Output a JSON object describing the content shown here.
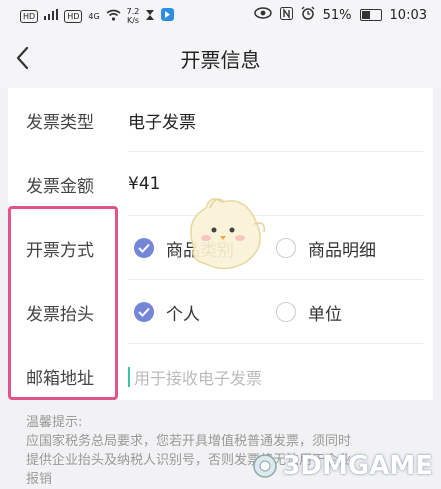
{
  "status_bar": {
    "hd1": "HD",
    "hd2": "HD",
    "signal1": "4G",
    "speed": "7.2",
    "speed_unit": "K/s",
    "battery": "51%",
    "time": "10:03",
    "battery_level": 0.51
  },
  "nav": {
    "title": "开票信息",
    "back_icon": "chevron-left-icon"
  },
  "form": {
    "invoice_type": {
      "label": "发票类型",
      "value": "电子发票"
    },
    "invoice_amount": {
      "label": "发票金额",
      "value": "¥41"
    },
    "invoice_method": {
      "label": "开票方式",
      "options": [
        {
          "label": "商品类别",
          "selected": true
        },
        {
          "label": "商品明细",
          "selected": false
        }
      ]
    },
    "invoice_title": {
      "label": "发票抬头",
      "options": [
        {
          "label": "个人",
          "selected": true
        },
        {
          "label": "单位",
          "selected": false
        }
      ]
    },
    "email": {
      "label": "邮箱地址",
      "placeholder": "用于接收电子发票"
    }
  },
  "tip": {
    "heading": "温馨提示:",
    "line1": "应国家税务总局要求，您若开具增值税普通发票，须同时",
    "line2": "提供企业抬头及纳税人识别号，否则发票将无法用于企业",
    "line3": "报销"
  },
  "watermark": {
    "text": "3DMGAME"
  },
  "colors": {
    "accent": "#7586d6",
    "highlight": "#e0548b",
    "caret": "#3ec1a8"
  }
}
